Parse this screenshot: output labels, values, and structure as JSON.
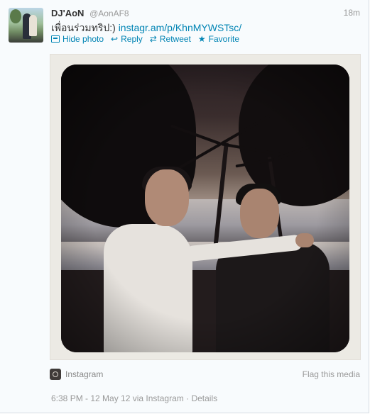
{
  "tweet": {
    "full_name": "DJ'AoN",
    "handle": "@AonAF8",
    "time": "18m",
    "text_prefix": "เพื่อนร่วมทริป:) ",
    "link_text": "instagr.am/p/KhnMYWSTsc/"
  },
  "actions": {
    "hide_photo": "Hide photo",
    "reply": "Reply",
    "retweet": "Retweet",
    "favorite": "Favorite"
  },
  "media": {
    "provider": "Instagram",
    "flag": "Flag this media"
  },
  "meta": {
    "timestamp": "6:38 PM - 12 May 12",
    "via_prefix": " via ",
    "via_source": "Instagram",
    "separator": " · ",
    "details": "Details"
  },
  "icons": {
    "hide_photo": "photo-icon",
    "reply": "reply-icon",
    "retweet": "retweet-icon",
    "favorite": "star-icon",
    "provider": "instagram-icon"
  },
  "colors": {
    "link": "#0084b4",
    "muted": "#999999"
  }
}
